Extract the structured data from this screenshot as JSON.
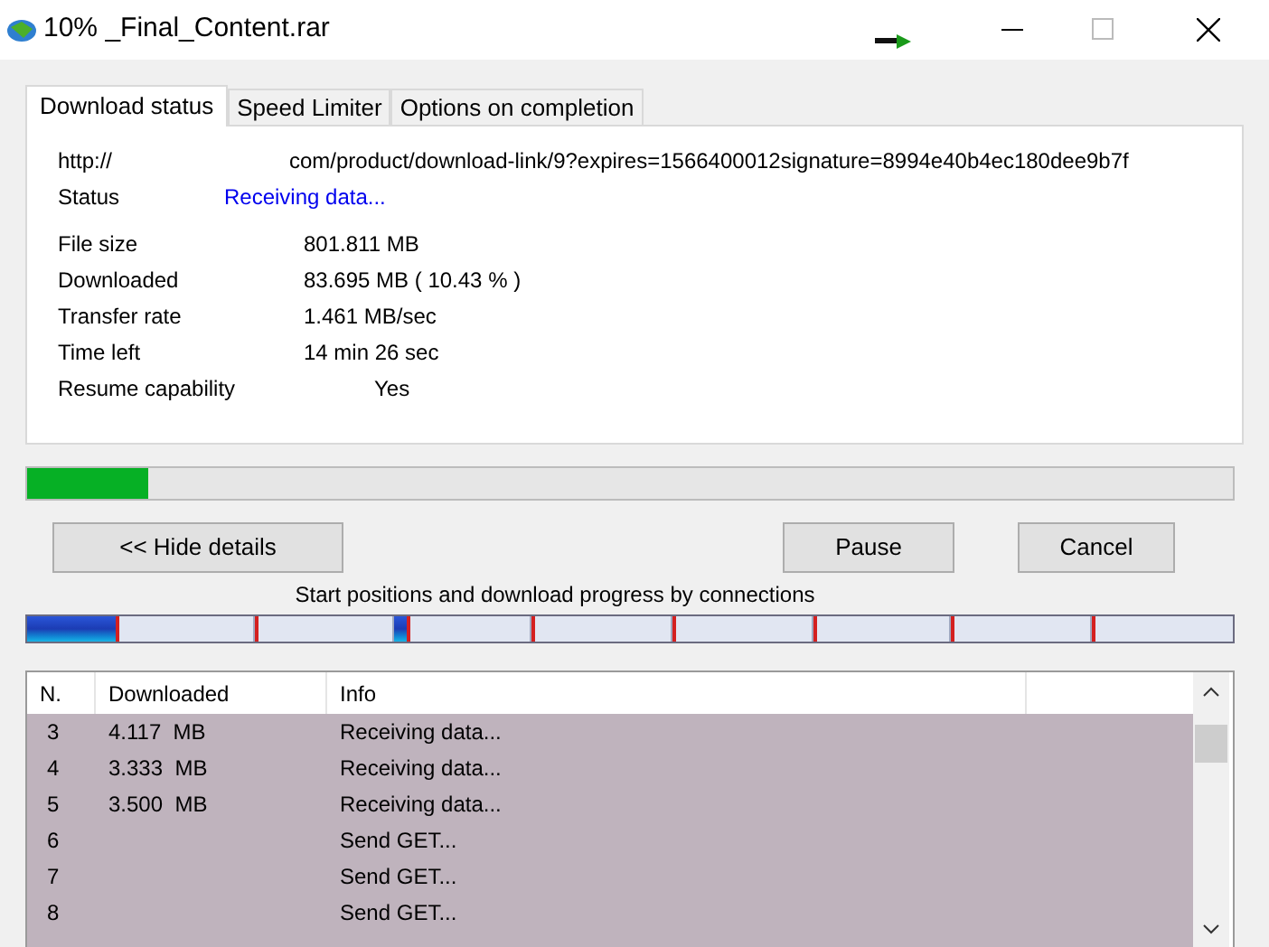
{
  "window": {
    "title": "10% _Final_Content.rar"
  },
  "tabs": [
    {
      "label": "Download status",
      "selected": true
    },
    {
      "label": "Speed Limiter",
      "selected": false
    },
    {
      "label": "Options on completion",
      "selected": false
    }
  ],
  "details": [
    {
      "kind": "url",
      "label": "http://",
      "value": "com/product/download-link/9?expires=1566400012signature=8994e40b4ec180dee9b7f"
    },
    {
      "kind": "status",
      "label": "Status",
      "value": "Receiving data..."
    },
    {
      "kind": "info",
      "label": "File size",
      "value": "801.811  MB"
    },
    {
      "kind": "info",
      "label": "Downloaded",
      "value": "83.695  MB  ( 10.43 % )"
    },
    {
      "kind": "info",
      "label": "Transfer rate",
      "value": "1.461  MB/sec"
    },
    {
      "kind": "info",
      "label": "Time left",
      "value": "14 min 26 sec"
    },
    {
      "kind": "resume",
      "label": "Resume capability",
      "value": "Yes"
    }
  ],
  "progress": {
    "level": 0.1
  },
  "buttons": [
    "<< Hide details",
    "Pause",
    "Cancel"
  ],
  "connections_caption": "Start positions and download progress by connections",
  "connections": [
    {
      "level": 0.41
    },
    {
      "level": 0
    },
    {
      "level": 0.12
    },
    {
      "level": 0
    },
    {
      "level": 0.03
    },
    {
      "level": 0
    },
    {
      "level": 0.02
    },
    {
      "level": 0.02
    }
  ],
  "table": {
    "columns": [
      "N.",
      "Downloaded",
      "Info"
    ],
    "rows": [
      {
        "n": "3",
        "downloaded": "4.117  MB",
        "info": "Receiving data..."
      },
      {
        "n": "4",
        "downloaded": "3.333  MB",
        "info": "Receiving data..."
      },
      {
        "n": "5",
        "downloaded": "3.500  MB",
        "info": "Receiving data..."
      },
      {
        "n": "6",
        "info": "Send GET..."
      },
      {
        "n": "7",
        "info": "Send GET..."
      },
      {
        "n": "8",
        "info": "Send GET..."
      }
    ]
  }
}
